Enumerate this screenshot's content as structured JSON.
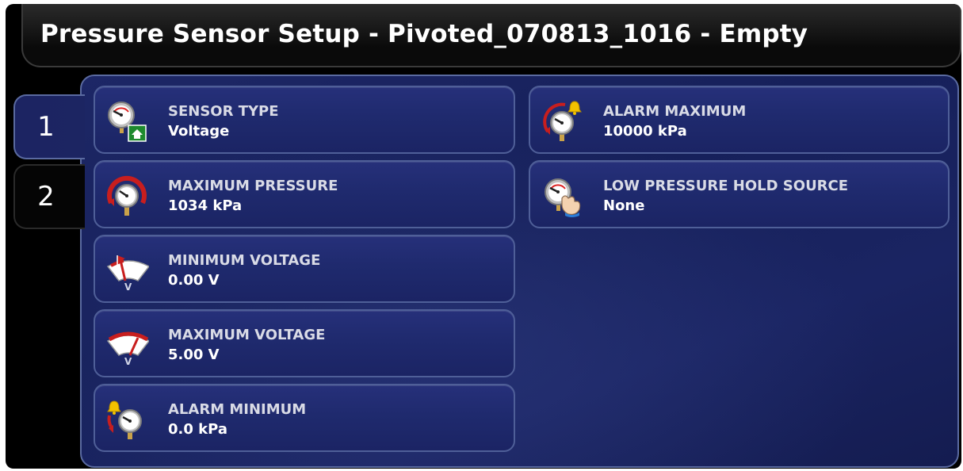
{
  "header": {
    "title": "Pressure Sensor Setup - Pivoted_070813_1016 - Empty"
  },
  "tabs": [
    {
      "label": "1",
      "selected": true
    },
    {
      "label": "2",
      "selected": false
    }
  ],
  "settings_left": [
    {
      "label": "SENSOR TYPE",
      "value": "Voltage",
      "icon": "pressure-gauge-home-icon"
    },
    {
      "label": "MAXIMUM PRESSURE",
      "value": "1034 kPa",
      "icon": "pressure-gauge-max-icon"
    },
    {
      "label": "MINIMUM VOLTAGE",
      "value": "0.00 V",
      "icon": "voltmeter-min-icon"
    },
    {
      "label": "MAXIMUM VOLTAGE",
      "value": "5.00 V",
      "icon": "voltmeter-max-icon"
    },
    {
      "label": "ALARM MINIMUM",
      "value": "0.0 kPa",
      "icon": "pressure-alarm-min-icon"
    }
  ],
  "settings_right": [
    {
      "label": "ALARM MAXIMUM",
      "value": "10000 kPa",
      "icon": "pressure-alarm-max-icon"
    },
    {
      "label": "LOW PRESSURE HOLD SOURCE",
      "value": "None",
      "icon": "pressure-hold-hand-icon"
    }
  ],
  "colors": {
    "panel_blue": "#1c2562",
    "button_blue": "#222c72",
    "border": "#5a6aa0",
    "text": "#ffffff",
    "label_text": "#d9dbe6"
  }
}
